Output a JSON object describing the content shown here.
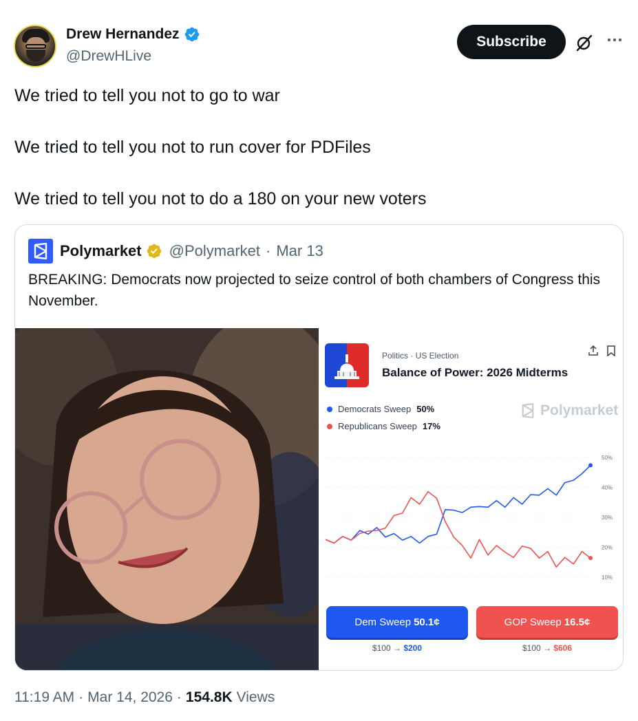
{
  "author": {
    "name": "Drew Hernandez",
    "handle": "@DrewHLive"
  },
  "actions": {
    "subscribe_label": "Subscribe",
    "grok_icon": "grok-icon",
    "more_icon": "more-icon"
  },
  "tweet": {
    "lines": [
      "We tried to tell you not to go to war",
      "We tried to tell you not to run cover for PDFiles",
      "We tried to tell you not to do a 180 on your new voters"
    ]
  },
  "quote": {
    "name": "Polymarket",
    "handle": "@Polymarket",
    "separator": "·",
    "date": "Mar 13",
    "text": "BREAKING: Democrats now projected to seize control of both chambers of Congress this November."
  },
  "card": {
    "category": "Politics · US Election",
    "title": "Balance of Power: 2026 Midterms",
    "watermark": "Polymarket",
    "legend": [
      {
        "label": "Democrats Sweep",
        "value": "50%",
        "color": "#1f58f0"
      },
      {
        "label": "Republicans Sweep",
        "value": "17%",
        "color": "#f0524f"
      }
    ],
    "buttons": {
      "dem_label": "Dem Sweep",
      "dem_price": "50.1¢",
      "gop_label": "GOP Sweep",
      "gop_price": "16.5¢"
    },
    "payouts": {
      "dem_from": "$100 →",
      "dem_to": "$200",
      "gop_from": "$100 →",
      "gop_to": "$606"
    }
  },
  "chart_data": {
    "type": "line",
    "y_ticks": [
      "50%",
      "40%",
      "30%",
      "20%",
      "10%"
    ],
    "ylim": [
      10,
      50
    ],
    "series": [
      {
        "name": "Democrats Sweep",
        "color": "#1f58f0",
        "values": [
          22,
          22,
          23,
          23,
          25,
          25,
          26,
          24,
          24,
          23,
          23,
          22,
          23,
          25,
          32,
          33,
          31,
          34,
          33,
          34,
          35,
          34,
          36,
          35,
          37,
          38,
          39,
          38,
          41,
          43,
          44,
          48
        ]
      },
      {
        "name": "Republicans Sweep",
        "color": "#f0524f",
        "values": [
          22,
          22,
          23,
          23,
          24,
          26,
          25,
          27,
          30,
          32,
          36,
          35,
          38,
          37,
          28,
          24,
          20,
          17,
          22,
          18,
          20,
          19,
          16,
          21,
          19,
          17,
          18,
          14,
          16,
          15,
          18,
          17
        ]
      }
    ]
  },
  "meta": {
    "time": "11:19 AM",
    "sep1": "·",
    "date": "Mar 14, 2026",
    "sep2": "·",
    "views_num": "154.8K",
    "views_label": "Views"
  }
}
